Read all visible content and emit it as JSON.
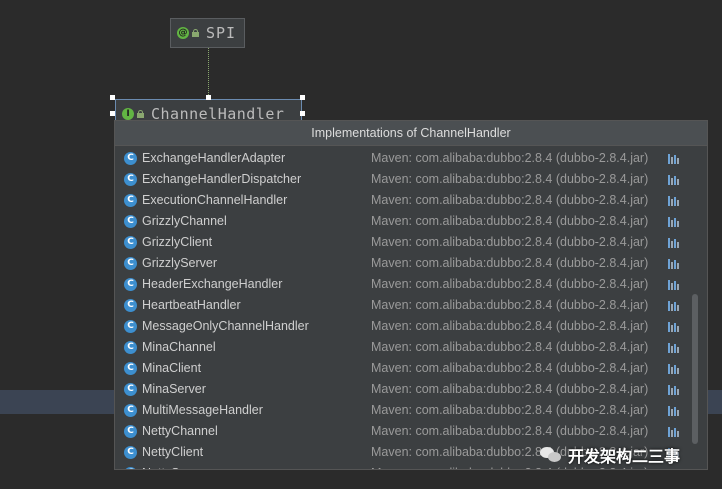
{
  "diagram": {
    "nodes": [
      {
        "label": "SPI",
        "badge": "@"
      },
      {
        "label": "ChannelHandler",
        "badge": "I"
      }
    ]
  },
  "popup": {
    "title": "Implementations of ChannelHandler",
    "location_text": "Maven: com.alibaba:dubbo:2.8.4 (dubbo-2.8.4.jar)",
    "class_badge": "C",
    "items": [
      "ExchangeHandlerAdapter",
      "ExchangeHandlerDispatcher",
      "ExecutionChannelHandler",
      "GrizzlyChannel",
      "GrizzlyClient",
      "GrizzlyServer",
      "HeaderExchangeHandler",
      "HeartbeatHandler",
      "MessageOnlyChannelHandler",
      "MinaChannel",
      "MinaClient",
      "MinaServer",
      "MultiMessageHandler",
      "NettyChannel",
      "NettyClient",
      "NettyServer"
    ]
  },
  "watermark": {
    "text": "开发架构二三事"
  },
  "colors": {
    "background": "#2b2b2b",
    "popup_bg": "#3c3f41",
    "class_icon": "#3d8fcf",
    "interface_icon": "#62b543"
  },
  "icons": {
    "annotation": "annotation-icon",
    "interface": "interface-icon",
    "class": "class-icon",
    "jar": "jar-library-icon",
    "wechat": "wechat-icon"
  }
}
